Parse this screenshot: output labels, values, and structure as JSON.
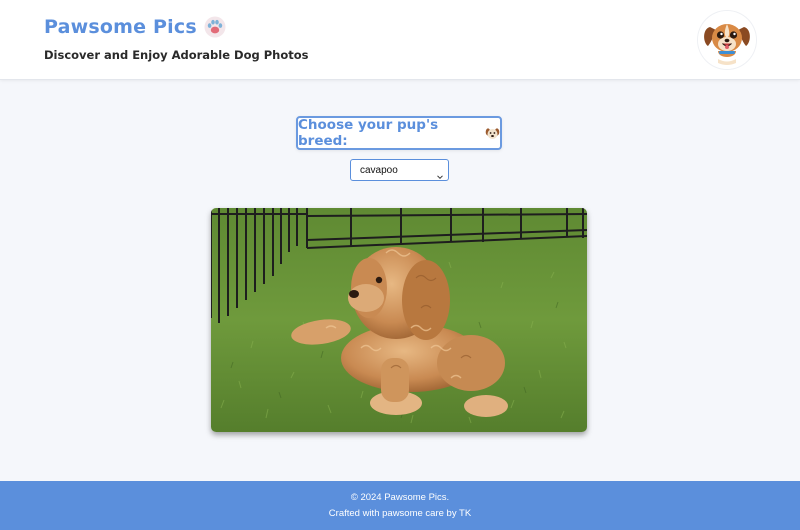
{
  "header": {
    "title": "Pawsome Pics",
    "title_icon": "paw-print-icon",
    "tagline": "Discover and Enjoy Adorable Dog Photos",
    "avatar_icon": "cartoon-dog-avatar"
  },
  "breed_selector": {
    "label": "Choose your pup's breed:",
    "label_icon": "dog-face-emoji-icon",
    "selected": "cavapoo"
  },
  "photo": {
    "subject": "cavapoo-dog-on-grass-photo"
  },
  "footer": {
    "copyright": "© 2024 Pawsome Pics.",
    "credit": "Crafted with pawsome care by TK"
  },
  "colors": {
    "accent": "#5b8fdc",
    "background": "#f5f7fb",
    "footer": "#5b8fdc"
  }
}
